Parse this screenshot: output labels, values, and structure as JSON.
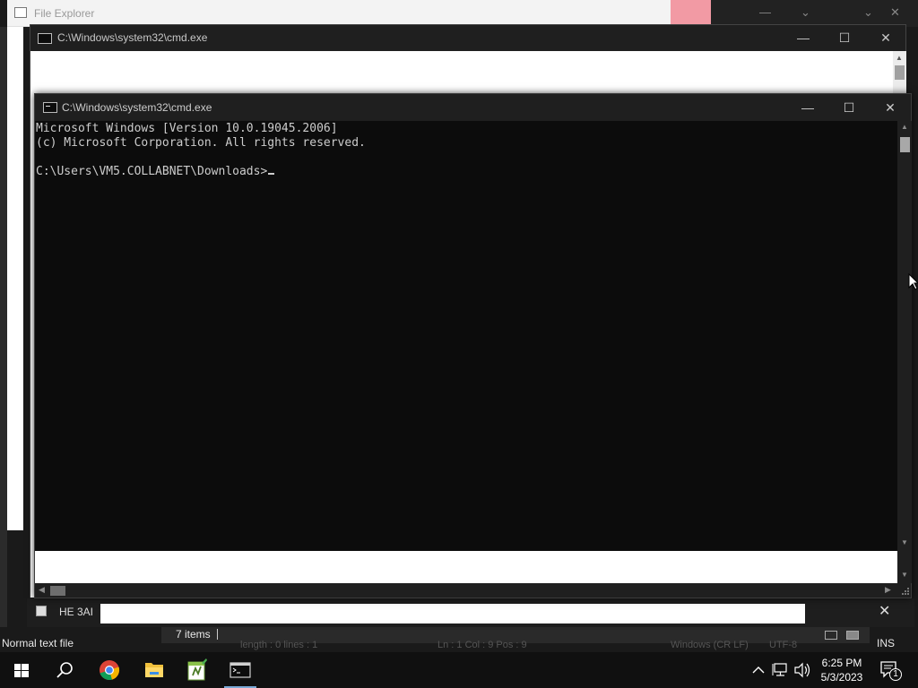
{
  "background": {
    "explorer_title": "File Explorer",
    "notepad_title": "HE 3AI",
    "status_left": "Normal text file",
    "items_count": "7 items",
    "status_ins": "INS",
    "status_ghost": {
      "length_lines": "length : 0    lines : 1",
      "pos": "Ln : 1    Col : 9    Pos : 9",
      "eol": "Windows (CR LF)",
      "encoding": "UTF-8"
    }
  },
  "cmd_back": {
    "title": "C:\\Windows\\system32\\cmd.exe"
  },
  "cmd_front": {
    "title": "C:\\Windows\\system32\\cmd.exe",
    "lines": [
      "Microsoft Windows [Version 10.0.19045.2006]",
      "(c) Microsoft Corporation. All rights reserved.",
      "",
      "C:\\Users\\VM5.COLLABNET\\Downloads>"
    ]
  },
  "window_controls": {
    "minimize": "—",
    "maximize": "☐",
    "close": "✕"
  },
  "taskbar": {
    "apps": [
      {
        "name": "start",
        "icon": "windows-logo-icon"
      },
      {
        "name": "search",
        "icon": "search-icon"
      },
      {
        "name": "chrome",
        "icon": "chrome-icon"
      },
      {
        "name": "file-explorer",
        "icon": "folder-icon"
      },
      {
        "name": "notepad-plus-plus",
        "icon": "notepad-icon"
      },
      {
        "name": "command-prompt",
        "icon": "terminal-icon"
      }
    ],
    "time": "6:25 PM",
    "date": "5/3/2023",
    "notification_count": "1"
  },
  "colors": {
    "console_bg": "#0c0c0c",
    "console_text": "#cccccc",
    "titlebar": "#1f1f1f",
    "taskbar": "#101010"
  }
}
